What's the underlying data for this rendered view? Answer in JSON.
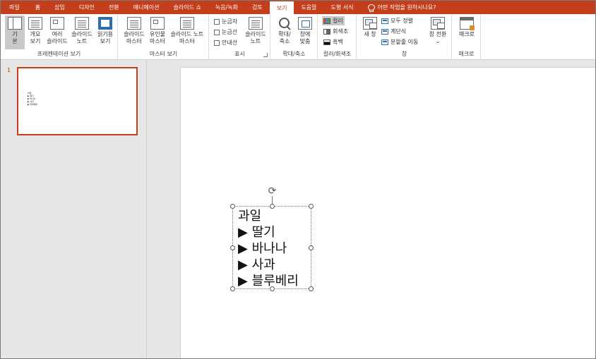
{
  "tabs": [
    {
      "label": "파일",
      "active": false
    },
    {
      "label": "홈",
      "active": false
    },
    {
      "label": "삽입",
      "active": false
    },
    {
      "label": "디자인",
      "active": false
    },
    {
      "label": "전환",
      "active": false
    },
    {
      "label": "애니메이션",
      "active": false
    },
    {
      "label": "슬라이드 쇼",
      "active": false
    },
    {
      "label": "녹음/녹화",
      "active": false
    },
    {
      "label": "검토",
      "active": false
    },
    {
      "label": "보기",
      "active": true
    },
    {
      "label": "도움말",
      "active": false
    },
    {
      "label": "도형 서식",
      "active": false
    }
  ],
  "tell_me": "어떤 작업을 원하시나요?",
  "ribbon": {
    "presentation_views": {
      "label": "프레젠테이션 보기",
      "normal": "기\n본",
      "outline": "개요\n보기",
      "slide_sorter": "여러\n슬라이드",
      "notes_page": "슬라이드\n노트",
      "reading": "읽기용\n보기"
    },
    "master_views": {
      "label": "마스터 보기",
      "slide_master": "슬라이드\n마스터",
      "handout_master": "유인물\n마스터",
      "notes_master": "슬라이드 노트\n마스터"
    },
    "show": {
      "label": "표시",
      "ruler": "눈금자",
      "gridlines": "눈금선",
      "guides": "안내선",
      "notes": "슬라이드\n노트"
    },
    "zoom": {
      "label": "확대/축소",
      "zoom": "확대/\n축소",
      "fit": "창에\n맞춤"
    },
    "color": {
      "label": "컬러/회색조",
      "color": "컬러",
      "grayscale": "회색조",
      "bw": "흑백"
    },
    "window": {
      "label": "창",
      "new_window": "새 창",
      "arrange_all": "모두 정렬",
      "cascade": "계단식",
      "move_split": "분할줄 이동",
      "switch": "창 전환\n⌄"
    },
    "macros": {
      "label": "매크로",
      "macro": "매크로"
    }
  },
  "thumbnails": {
    "slide_number": "1",
    "text": "과일\n▶ 딸기\n▶ 바나나\n▶ 사과\n▶ 블루베리"
  },
  "textbox": {
    "lines": [
      "과일",
      "▶ 딸기",
      "▶ 바나나",
      "▶ 사과",
      "▶ 블루베리"
    ]
  }
}
